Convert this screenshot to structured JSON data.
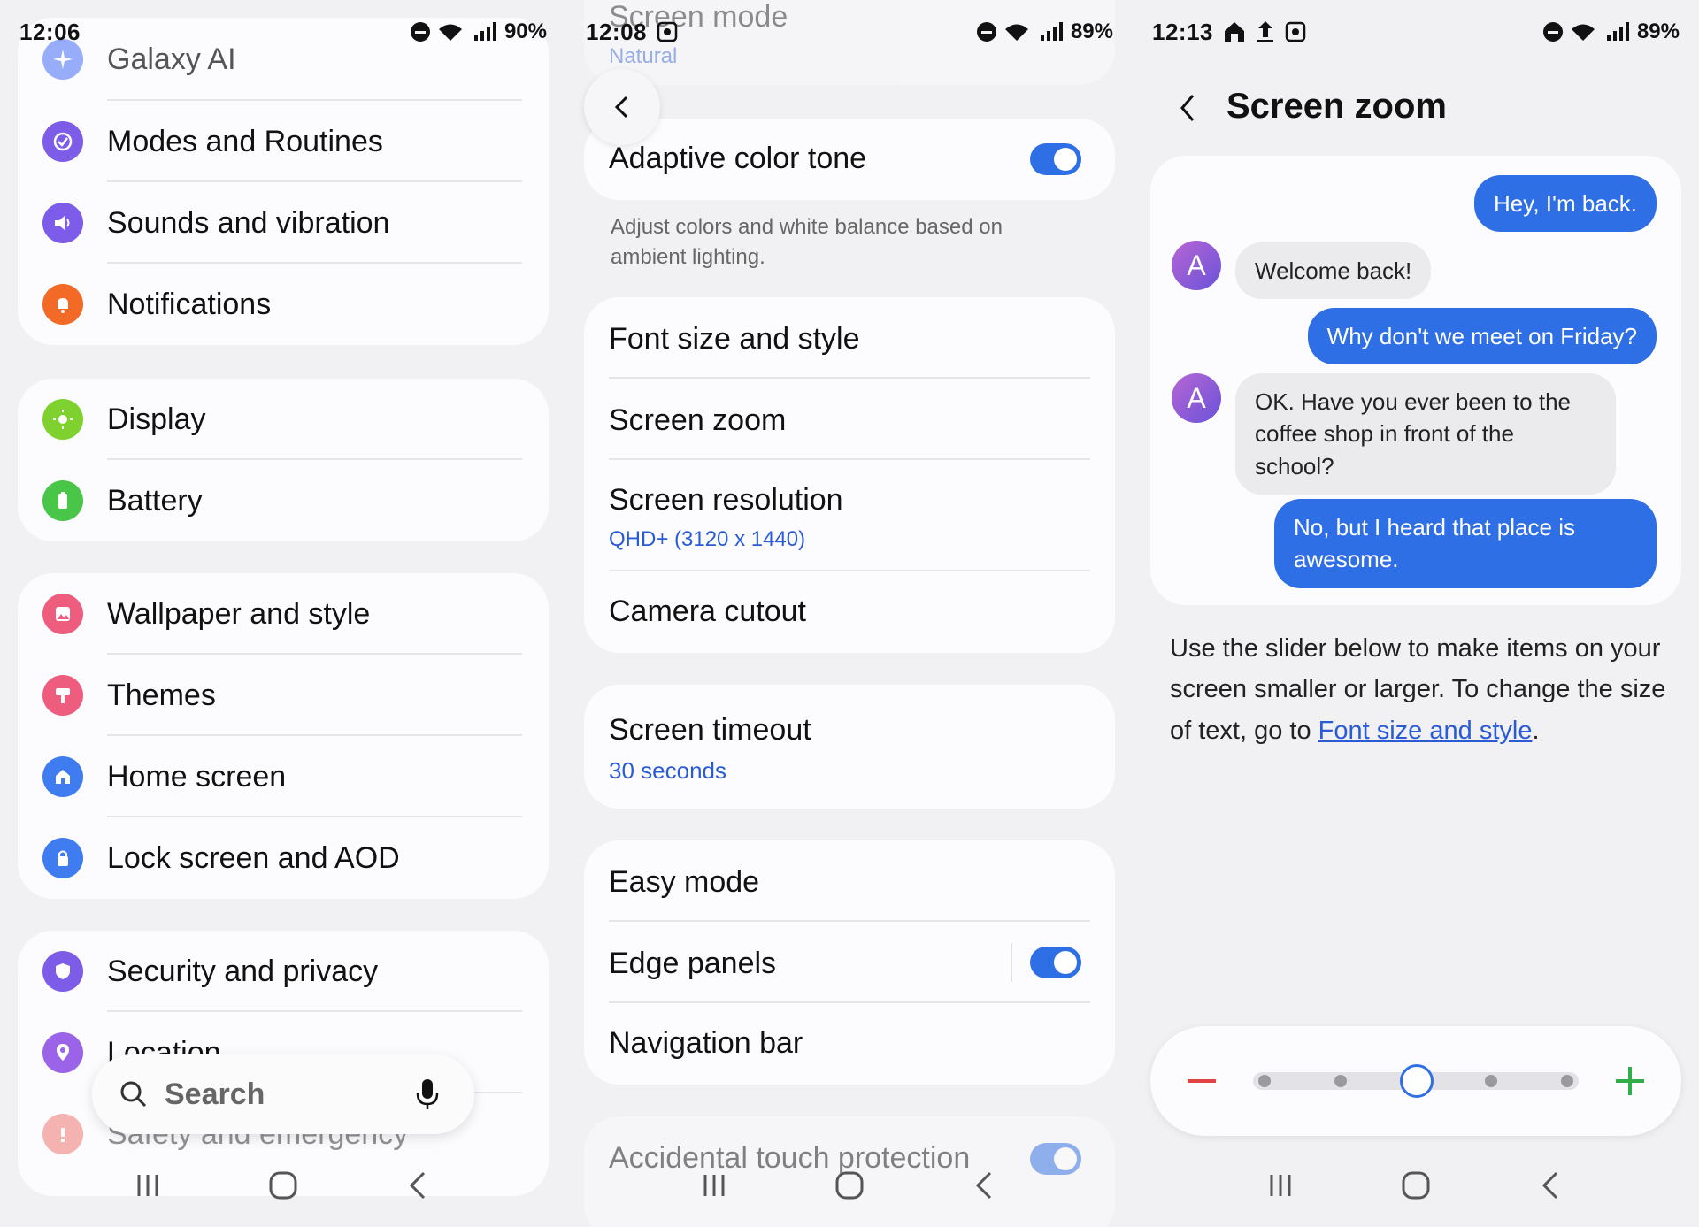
{
  "panel1": {
    "status": {
      "time": "12:06",
      "battery": "90%"
    },
    "groups": [
      {
        "items": [
          {
            "label": "Galaxy AI",
            "icon": "galaxy-ai-icon",
            "color": "#6e8cf7"
          },
          {
            "label": "Modes and Routines",
            "icon": "modes-routines-icon",
            "color": "#7d5ce8"
          },
          {
            "label": "Sounds and vibration",
            "icon": "sound-icon",
            "color": "#7c5ce8"
          },
          {
            "label": "Notifications",
            "icon": "bell-icon",
            "color": "#f26a25"
          }
        ]
      },
      {
        "items": [
          {
            "label": "Display",
            "icon": "sun-icon",
            "color": "#7fd12f"
          },
          {
            "label": "Battery",
            "icon": "battery-icon",
            "color": "#49c548"
          }
        ]
      },
      {
        "items": [
          {
            "label": "Wallpaper and style",
            "icon": "wallpaper-icon",
            "color": "#ee5d7e"
          },
          {
            "label": "Themes",
            "icon": "brush-icon",
            "color": "#ee5d7e"
          },
          {
            "label": "Home screen",
            "icon": "home-icon",
            "color": "#3f7cf0"
          },
          {
            "label": "Lock screen and AOD",
            "icon": "lock-icon",
            "color": "#3f7cf0"
          }
        ]
      },
      {
        "items": [
          {
            "label": "Security and privacy",
            "icon": "shield-icon",
            "color": "#7d5ce8"
          },
          {
            "label": "Location",
            "icon": "location-icon",
            "color": "#9b64e8"
          },
          {
            "label": "Safety and emergency",
            "icon": "alert-icon",
            "color": "#ec5a56"
          }
        ]
      }
    ],
    "search": {
      "placeholder": "Search"
    }
  },
  "panel2": {
    "status": {
      "time": "12:08",
      "battery": "89%"
    },
    "top": {
      "title": "Screen mode",
      "value": "Natural"
    },
    "adaptive": {
      "label": "Adaptive color tone",
      "on": true,
      "description": "Adjust colors and white balance based on ambient lighting."
    },
    "group1": [
      {
        "label": "Font size and style"
      },
      {
        "label": "Screen zoom"
      },
      {
        "label": "Screen resolution",
        "sub": "QHD+ (3120 x 1440)"
      },
      {
        "label": "Camera cutout"
      }
    ],
    "timeout": {
      "label": "Screen timeout",
      "sub": "30 seconds"
    },
    "group2": [
      {
        "label": "Easy mode"
      },
      {
        "label": "Edge panels",
        "toggle": true
      },
      {
        "label": "Navigation bar"
      }
    ],
    "accidental": {
      "label": "Accidental touch protection",
      "on": true
    }
  },
  "panel3": {
    "status": {
      "time": "12:13",
      "battery": "89%"
    },
    "title": "Screen zoom",
    "avatar_letter": "A",
    "chat": [
      {
        "dir": "out",
        "text": "Hey, I'm back."
      },
      {
        "dir": "in",
        "text": "Welcome back!"
      },
      {
        "dir": "out",
        "text": "Why don't we meet on Friday?"
      },
      {
        "dir": "in",
        "text": "OK. Have you ever been to the coffee shop in front of the school?"
      },
      {
        "dir": "out",
        "text": "No, but I heard that place is awesome."
      }
    ],
    "description_prefix": "Use the slider below to make items on your screen smaller or larger. To change the size of text, go to ",
    "description_link": "Font size and style",
    "description_suffix": ".",
    "slider": {
      "steps": 5,
      "selected_index": 2
    }
  },
  "colors": {
    "accent": "#2f6fe6",
    "link": "#2a5bd7",
    "minus": "#e04545",
    "plus": "#2fae4a"
  }
}
